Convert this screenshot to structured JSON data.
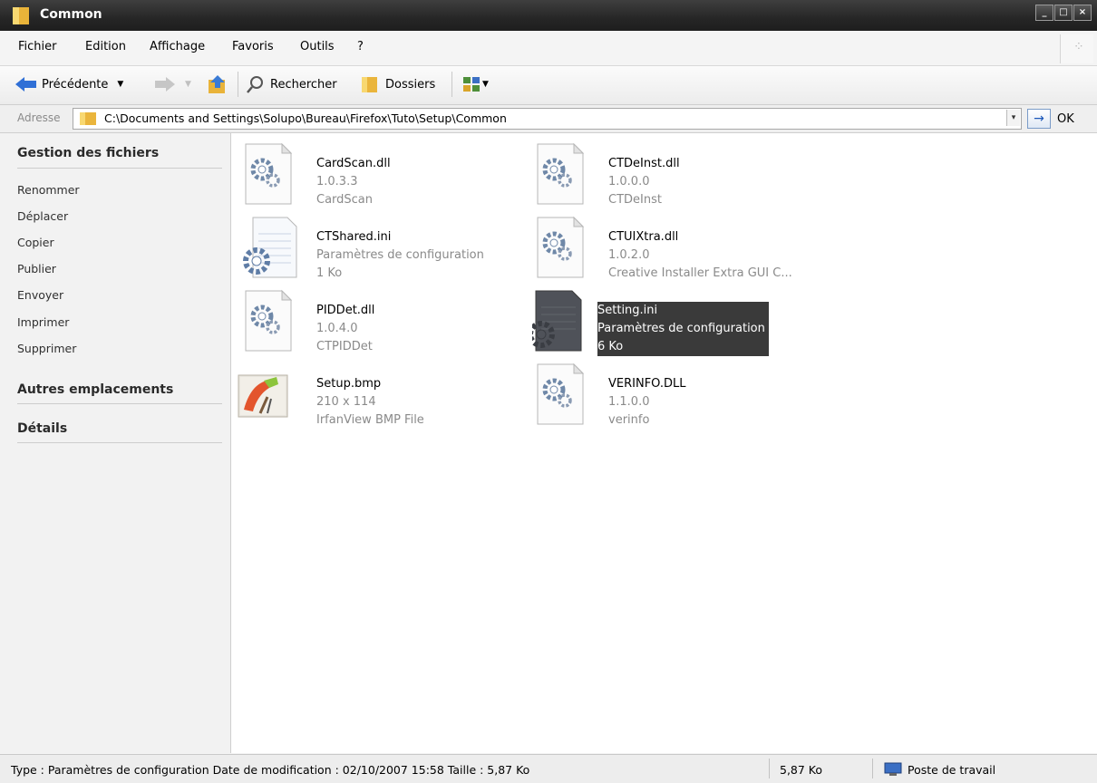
{
  "window": {
    "title": "Common"
  },
  "menu": [
    "Fichier",
    "Edition",
    "Affichage",
    "Favoris",
    "Outils",
    "?"
  ],
  "toolbar": {
    "back_label": "Précédente",
    "search_label": "Rechercher",
    "folders_label": "Dossiers"
  },
  "address": {
    "label": "Adresse",
    "path": "C:\\Documents and Settings\\Solupo\\Bureau\\Firefox\\Tuto\\Setup\\Common",
    "go_label": "OK"
  },
  "tasks": {
    "file_tasks_title": "Gestion des fichiers",
    "file_tasks": [
      "Renommer",
      "Déplacer",
      "Copier",
      "Publier",
      "Envoyer",
      "Imprimer",
      "Supprimer"
    ],
    "other_places_title": "Autres emplacements",
    "details_title": "Détails"
  },
  "files": [
    {
      "name": "CardScan.dll",
      "line2": "1.0.3.3",
      "line3": "CardScan",
      "icon": "dll-gear-icon",
      "selected": false
    },
    {
      "name": "CTDeInst.dll",
      "line2": "1.0.0.0",
      "line3": "CTDeInst",
      "icon": "dll-gear-icon",
      "selected": false
    },
    {
      "name": "CTShared.ini",
      "line2": "Paramètres de configuration",
      "line3": "1 Ko",
      "icon": "ini-settings-icon",
      "selected": false
    },
    {
      "name": "CTUIXtra.dll",
      "line2": "1.0.2.0",
      "line3": "Creative Installer Extra GUI C...",
      "icon": "dll-gear-icon",
      "selected": false
    },
    {
      "name": "PIDDet.dll",
      "line2": "1.0.4.0",
      "line3": "CTPIDDet",
      "icon": "dll-gear-icon",
      "selected": false
    },
    {
      "name": "Setting.ini",
      "line2": "Paramètres de configuration",
      "line3": "6 Ko",
      "icon": "ini-settings-icon",
      "selected": true
    },
    {
      "name": "Setup.bmp",
      "line2": "210 x 114",
      "line3": "IrfanView BMP File",
      "icon": "bmp-image-icon",
      "selected": false
    },
    {
      "name": "VERINFO.DLL",
      "line2": "1.1.0.0",
      "line3": "verinfo",
      "icon": "dll-gear-icon",
      "selected": false
    }
  ],
  "status": {
    "info": "Type : Paramètres de configuration Date de modification : 02/10/2007 15:58 Taille  : 5,87 Ko",
    "size": "5,87 Ko",
    "location": "Poste de travail"
  },
  "colors": {
    "selection": "#3a3a3a",
    "titlebar": "#262626",
    "go_arrow": "#1b57b9"
  }
}
